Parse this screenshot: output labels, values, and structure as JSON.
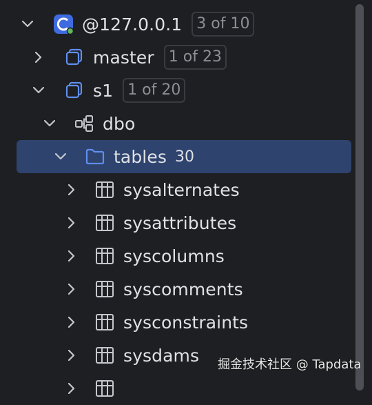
{
  "tree": {
    "connection": {
      "label": "@127.0.0.1",
      "badge": "3 of 10"
    },
    "databases": [
      {
        "label": "master",
        "badge": "1 of 23"
      },
      {
        "label": "s1",
        "badge": "1 of 20"
      }
    ],
    "schema": {
      "label": "dbo"
    },
    "tables_folder": {
      "label": "tables",
      "count": "30"
    },
    "tables": [
      {
        "label": "sysalternates"
      },
      {
        "label": "sysattributes"
      },
      {
        "label": "syscolumns"
      },
      {
        "label": "syscomments"
      },
      {
        "label": "sysconstraints"
      },
      {
        "label": "sysdams"
      }
    ]
  },
  "watermark": "掘金技术社区 @ Tapdata",
  "colors": {
    "background": "#1e1f22",
    "selection": "#2e436e",
    "text": "#dfe1e5",
    "badge_text": "#8c8f96",
    "icon_blue": "#5f8ff0",
    "status_green": "#5fb85a"
  }
}
